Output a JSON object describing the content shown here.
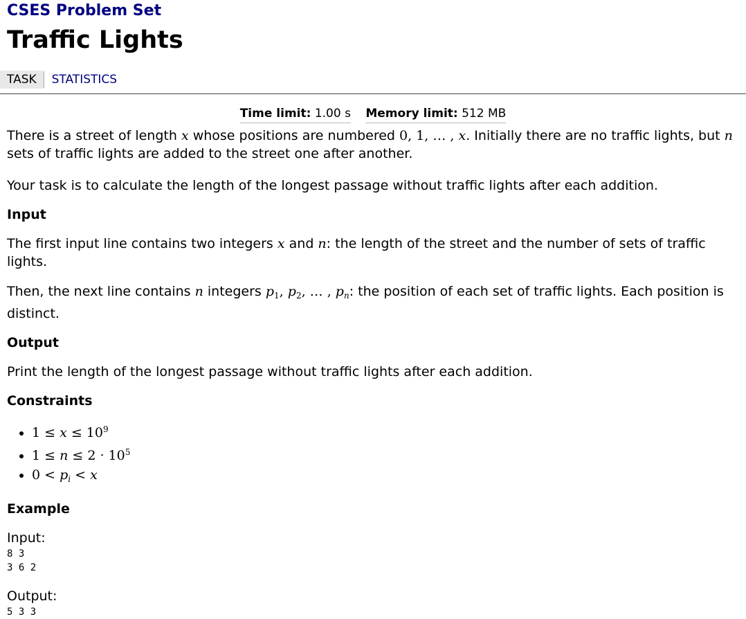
{
  "site": {
    "title": "CSES Problem Set"
  },
  "problem": {
    "title": "Traffic Lights"
  },
  "nav": {
    "task": "TASK",
    "statistics": "STATISTICS"
  },
  "limits": {
    "time_label": "Time limit:",
    "time_value": "1.00 s",
    "memory_label": "Memory limit:",
    "memory_value": "512 MB"
  },
  "statement": {
    "p1_a": "There is a street of length ",
    "p1_b": " whose positions are numbered ",
    "p1_c": ". Initially there are no traffic lights, but",
    "p1_d": " sets of traffic lights are added to the street one after another.",
    "p2": "Your task is to calculate the length of the longest passage without traffic lights after each addition."
  },
  "input": {
    "heading": "Input",
    "p1_a": "The first input line contains two integers ",
    "p1_b": " and ",
    "p1_c": ": the length of the street and the number of sets of traffic lights.",
    "p2_a": "Then, the next line contains ",
    "p2_b": " integers ",
    "p2_c": ": the position of each set of traffic lights. Each position is distinct."
  },
  "output": {
    "heading": "Output",
    "text": "Print the length of the longest passage without traffic lights after each addition."
  },
  "constraints": {
    "heading": "Constraints"
  },
  "example": {
    "heading": "Example",
    "input_label": "Input:",
    "input_lines": [
      "8 3",
      "3 6 2"
    ],
    "output_label": "Output:",
    "output_lines": [
      "5 3 3"
    ]
  }
}
